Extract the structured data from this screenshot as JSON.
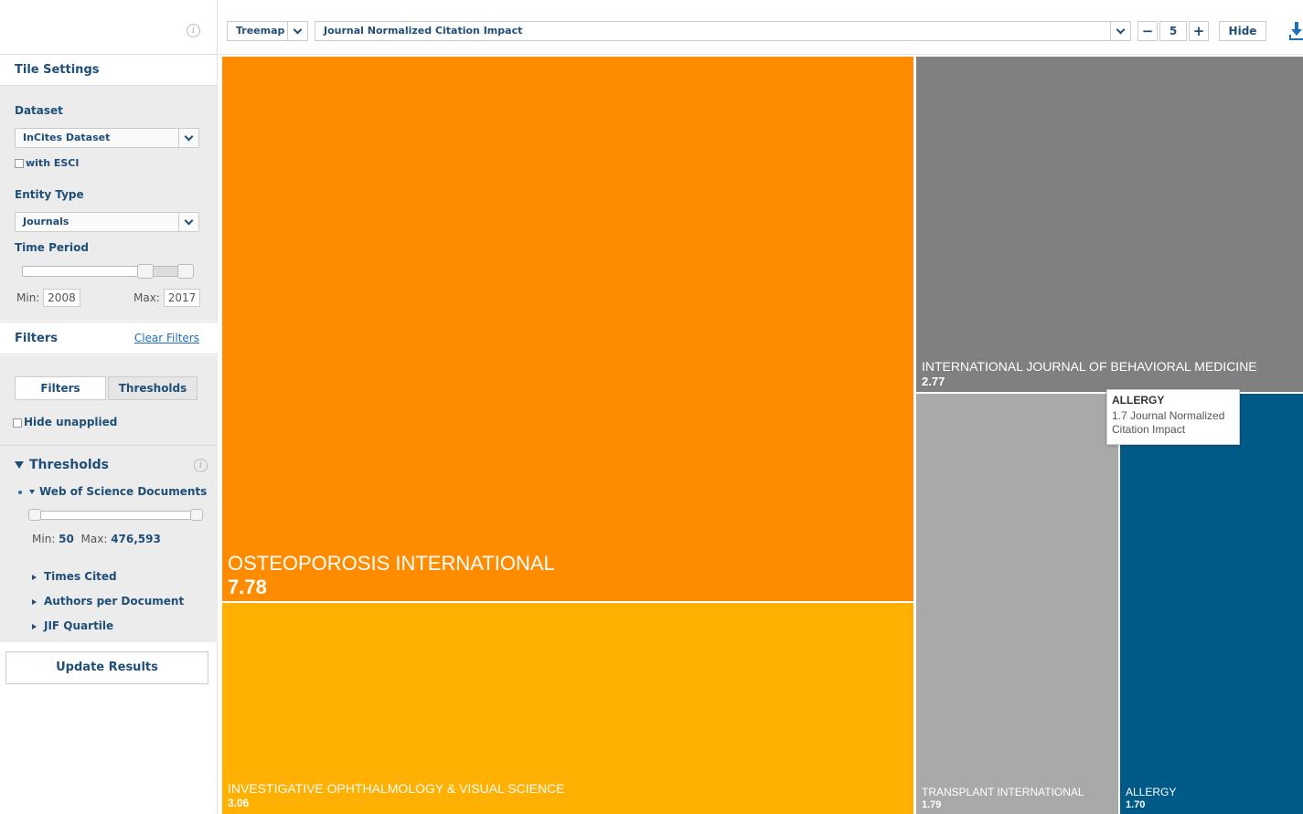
{
  "sidebar": {
    "tile_settings": "Tile Settings",
    "dataset_label": "Dataset",
    "dataset_value": "InCites Dataset",
    "with_esci": "with ESCI",
    "entity_type_label": "Entity Type",
    "entity_type_value": "Journals",
    "time_period_label": "Time Period",
    "time_min_label": "Min:",
    "time_min": "2008",
    "time_max_label": "Max:",
    "time_max": "2017",
    "filters_label": "Filters",
    "clear_filters": "Clear Filters",
    "tab_filters": "Filters",
    "tab_thresholds": "Thresholds",
    "hide_unapplied": "Hide unapplied",
    "thresholds_heading": "Thresholds",
    "wos_docs": "Web of Science Documents",
    "wos_min_label": "Min:",
    "wos_min": "50",
    "wos_max_label": "Max:",
    "wos_max": "476,593",
    "times_cited": "Times Cited",
    "authors_per_doc": "Authors per Document",
    "jif_quartile": "JIF Quartile",
    "update_results": "Update Results"
  },
  "toolbar": {
    "viz_type": "Treemap",
    "indicator": "Journal Normalized Citation Impact",
    "count": "5",
    "minus": "−",
    "plus": "+",
    "hide": "Hide",
    "download_icon": "download-icon"
  },
  "treemap": {
    "tiles": [
      {
        "name": "OSTEOPOROSIS INTERNATIONAL",
        "value": "7.78",
        "color": "#ff8c00"
      },
      {
        "name": "INVESTIGATIVE OPHTHALMOLOGY & VISUAL SCIENCE",
        "value": "3.06",
        "color": "#ffb000"
      },
      {
        "name": "INTERNATIONAL JOURNAL OF BEHAVIORAL MEDICINE",
        "value": "2.77",
        "color": "#808080"
      },
      {
        "name": "TRANSPLANT INTERNATIONAL",
        "value": "1.79",
        "color": "#a9a9a9"
      },
      {
        "name": "ALLERGY",
        "value": "1.70",
        "color": "#005a87"
      }
    ]
  },
  "tooltip": {
    "title": "ALLERGY",
    "body_line1": "1.7 Journal Normalized",
    "body_line2": "Citation Impact"
  }
}
